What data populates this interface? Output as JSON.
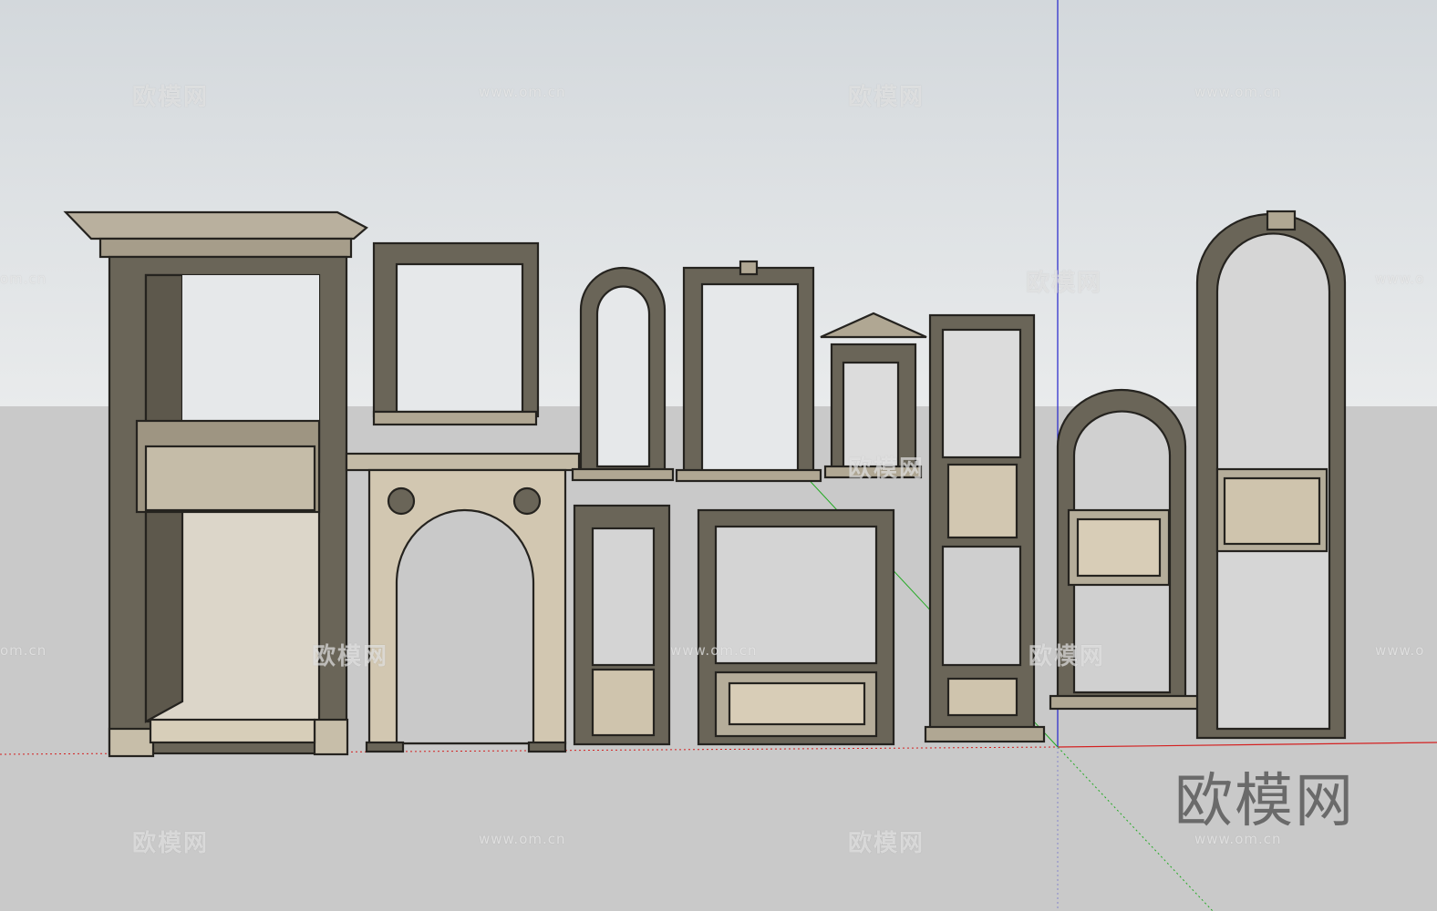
{
  "viewport": {
    "app": "3D modeling viewport",
    "sky_color": "#dde1e4",
    "ground_color": "#c9c9c9",
    "axis_colors": {
      "red": "#d42020",
      "green": "#22aa22",
      "blue": "#2020d0"
    }
  },
  "watermarks": {
    "brand": "欧模网",
    "url": "www.om.cn",
    "partial_url": "om.cn",
    "partial_url_right": "www.o"
  },
  "logo": {
    "text": "欧模网"
  },
  "models": [
    "tall-bookcase-frame-with-cornice",
    "square-window-frame",
    "fireplace-arch-carved",
    "round-arch-window",
    "rectangular-window-with-keystone",
    "pediment-window",
    "narrow-panel-door-frame",
    "wide-panel-frame",
    "tall-shelf-frame-with-panels",
    "arched-niche-with-carved-panel",
    "tall-arched-frame-with-carved-panel"
  ]
}
